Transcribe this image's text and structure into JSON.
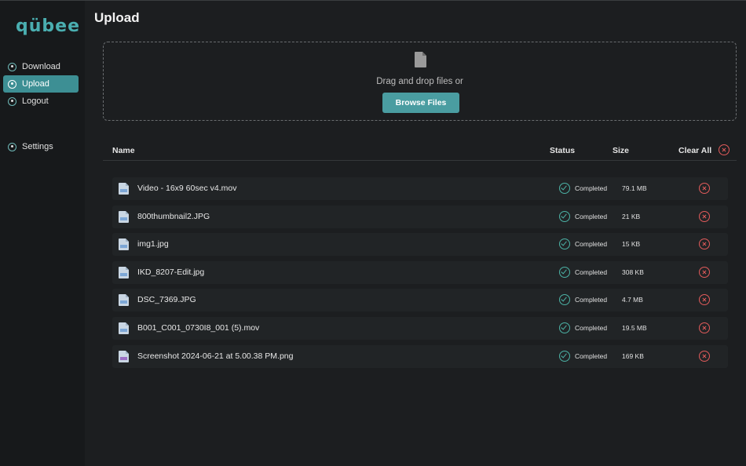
{
  "app": {
    "logo": "qübee"
  },
  "sidebar": {
    "items": [
      {
        "label": "Download",
        "icon": "download-icon"
      },
      {
        "label": "Upload",
        "icon": "upload-icon",
        "active": true
      },
      {
        "label": "Logout",
        "icon": "user-icon"
      },
      {
        "label": "Settings",
        "icon": "settings-icon"
      }
    ]
  },
  "page": {
    "title": "Upload"
  },
  "dropzone": {
    "text": "Drag and drop files or",
    "browse_label": "Browse Files",
    "icon": "file-icon"
  },
  "table": {
    "headers": {
      "name": "Name",
      "status": "Status",
      "size": "Size"
    },
    "clear_all_label": "Clear All",
    "rows": [
      {
        "name": "Video - 16x9 60sec v4.mov",
        "status": "Completed",
        "size": "79.1 MB",
        "kind": "video"
      },
      {
        "name": "800thumbnail2.JPG",
        "status": "Completed",
        "size": "21 KB",
        "kind": "image"
      },
      {
        "name": "img1.jpg",
        "status": "Completed",
        "size": "15 KB",
        "kind": "image"
      },
      {
        "name": "IKD_8207-Edit.jpg",
        "status": "Completed",
        "size": "308 KB",
        "kind": "image"
      },
      {
        "name": "DSC_7369.JPG",
        "status": "Completed",
        "size": "4.7 MB",
        "kind": "image"
      },
      {
        "name": "B001_C001_0730I8_001 (5).mov",
        "status": "Completed",
        "size": "19.5 MB",
        "kind": "video"
      },
      {
        "name": "Screenshot 2024-06-21 at 5.00.38 PM.png",
        "status": "Completed",
        "size": "169 KB",
        "kind": "png"
      }
    ]
  },
  "colors": {
    "accent": "#4a9da1",
    "success": "#4cb3a6",
    "danger": "#e25b5b",
    "background": "#1c1e20",
    "sidebar": "#17191b"
  }
}
